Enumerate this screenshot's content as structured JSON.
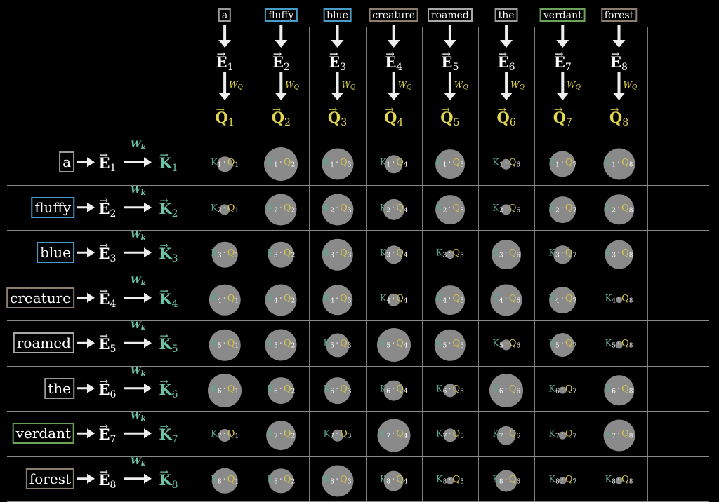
{
  "tokens": [
    {
      "word": "a",
      "border": "#9a9a9a"
    },
    {
      "word": "fluffy",
      "border": "#4a9cc6"
    },
    {
      "word": "blue",
      "border": "#4a9cc6"
    },
    {
      "word": "creature",
      "border": "#8b7d6f"
    },
    {
      "word": "roamed",
      "border": "#a8a8a8"
    },
    {
      "word": "the",
      "border": "#9a9a9a"
    },
    {
      "word": "verdant",
      "border": "#6ca35a"
    },
    {
      "word": "forest",
      "border": "#8b7d6f"
    }
  ],
  "symbols": {
    "embedding": "E",
    "query": "Q",
    "key": "K",
    "query_matrix": "W",
    "query_matrix_sub": "Q",
    "key_matrix": "W",
    "key_matrix_sub": "k",
    "vector_arrow": "⃗",
    "dot": "·"
  },
  "colors": {
    "background": "#000000",
    "query": "#e3d74f",
    "key": "#6cc3a8",
    "grid": "#8a8a8a",
    "circle": "#8a8a8a"
  },
  "grid_size": 8,
  "attention_magnitude": [
    [
      0.2,
      1.0,
      0.88,
      0.28,
      0.76,
      0.09,
      0.6,
      0.88
    ],
    [
      0.1,
      0.88,
      0.88,
      0.4,
      0.76,
      0.1,
      0.62,
      0.82
    ],
    [
      0.58,
      0.58,
      0.86,
      0.28,
      0.06,
      0.76,
      0.28,
      0.72
    ],
    [
      0.86,
      0.88,
      0.82,
      0.15,
      0.76,
      0.88,
      0.62,
      0.04
    ],
    [
      0.86,
      0.88,
      0.48,
      1.0,
      0.86,
      0.1,
      0.5,
      0.05
    ],
    [
      1.0,
      0.62,
      0.62,
      0.36,
      0.16,
      1.0,
      0.05,
      0.82
    ],
    [
      0.14,
      0.76,
      0.12,
      0.96,
      0.16,
      0.3,
      0.05,
      0.88
    ],
    [
      0.58,
      0.54,
      0.88,
      0.36,
      0.05,
      0.42,
      0.05,
      0.05
    ]
  ]
}
